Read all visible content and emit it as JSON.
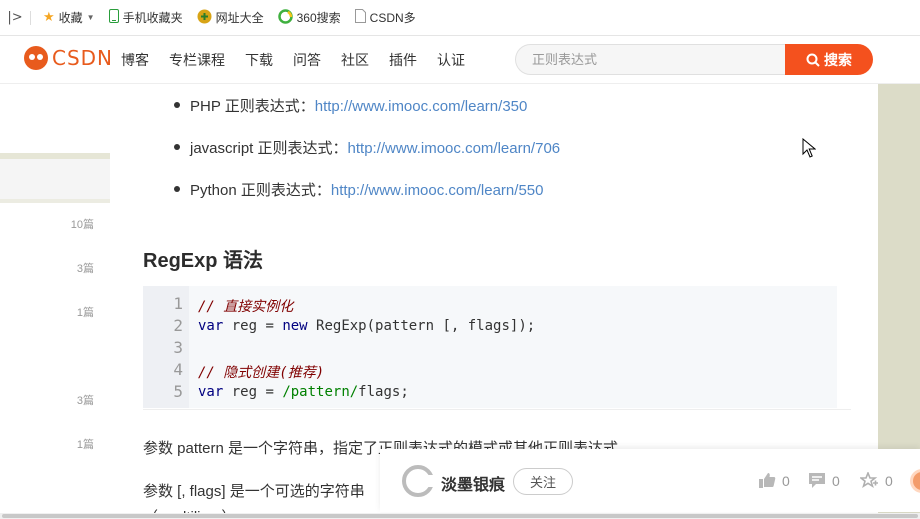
{
  "bookmarks": {
    "items": [
      {
        "label": "收藏",
        "icon": "star-icon",
        "has_caret": true
      },
      {
        "label": "手机收藏夹",
        "icon": "phone-icon"
      },
      {
        "label": "网址大全",
        "icon": "globe-icon"
      },
      {
        "label": "360搜索",
        "icon": "360-search-icon"
      },
      {
        "label": "CSDN多",
        "icon": "page-icon"
      }
    ]
  },
  "header": {
    "logo": "CSDN",
    "nav": [
      "博客",
      "专栏课程",
      "下载",
      "问答",
      "社区",
      "插件",
      "认证"
    ],
    "search": {
      "placeholder": "正则表达式",
      "button": "搜索"
    },
    "accent": "#f4511e"
  },
  "sidebar": {
    "counts": [
      "10篇",
      "3篇",
      "1篇",
      "3篇",
      "1篇"
    ]
  },
  "article": {
    "bullets": [
      {
        "text": "PHP 正则表达式：",
        "link": "http://www.imooc.com/learn/350"
      },
      {
        "text": "javascript 正则表达式：",
        "link": "http://www.imooc.com/learn/706"
      },
      {
        "text": "Python 正则表达式：",
        "link": "http://www.imooc.com/learn/550"
      }
    ],
    "heading": "RegExp 语法",
    "code": {
      "line_numbers": [
        "1",
        "2",
        "3",
        "4",
        "5"
      ],
      "line1": "// 直接实例化",
      "line2_kw1": "var",
      "line2_a": " reg = ",
      "line2_kw2": "new",
      "line2_b": " RegExp(pattern [, flags]);",
      "line4": "// 隐式创建(推荐)",
      "line5_kw": "var",
      "line5_a": " reg = ",
      "line5_rx": "/pattern/",
      "line5_b": "flags;"
    },
    "para1": "参数 pattern 是一个字符串，指定了正则表达式的模式或其他正则表达式",
    "para2": "参数 [, flags] 是一个可选的字符串",
    "para3": "（ multiline ）"
  },
  "toolbar": {
    "author": "淡墨银痕",
    "follow": "关注",
    "likes": "0",
    "comments": "0",
    "favorites": "0"
  }
}
